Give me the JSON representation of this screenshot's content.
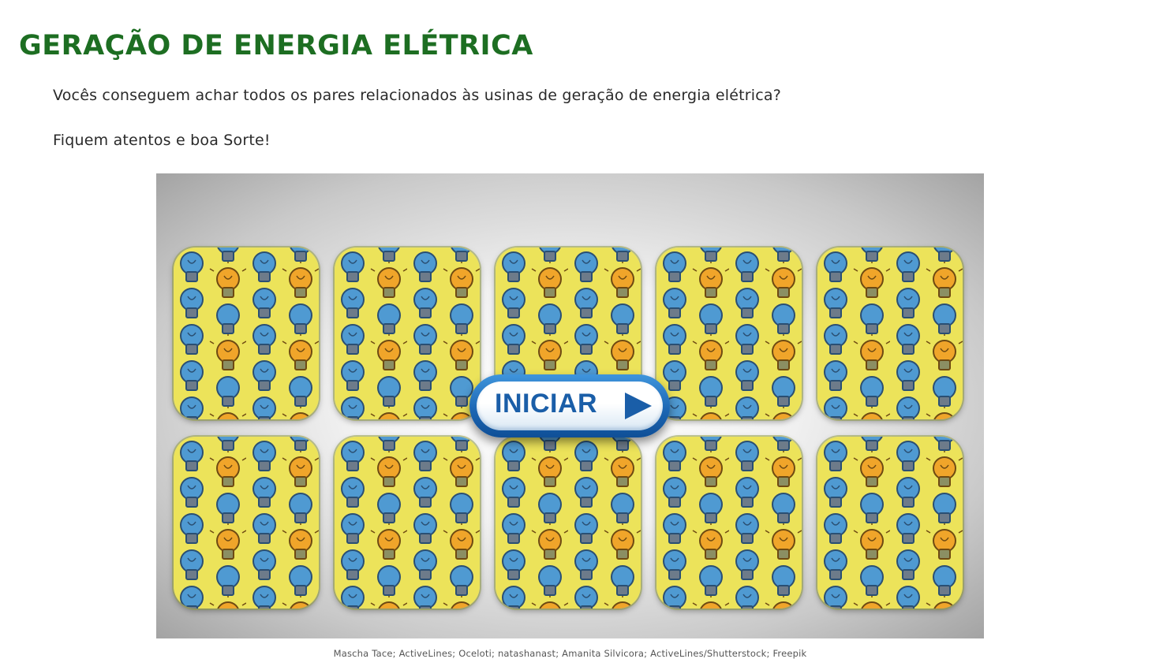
{
  "header": {
    "title": "GERAÇÃO DE ENERGIA ELÉTRICA"
  },
  "intro": {
    "question": "Vocês conseguem achar todos os pares relacionados às usinas de geração de energia elétrica?",
    "encouragement": "Fiquem atentos e boa Sorte!"
  },
  "game": {
    "start_label": "INICIAR",
    "card_count": 10,
    "card_pattern": "lightbulb-pattern"
  },
  "credits": "Mascha Tace; ActiveLines; Oceloti; natashanast; Amanita Silvicora; ActiveLines/Shutterstock; Freepik",
  "colors": {
    "title": "#1d6e22",
    "card_background": "#ece35a",
    "bulb_blue": "#4f9ad2",
    "bulb_orange": "#f0a52a",
    "button_blue": "#1d67b4"
  }
}
